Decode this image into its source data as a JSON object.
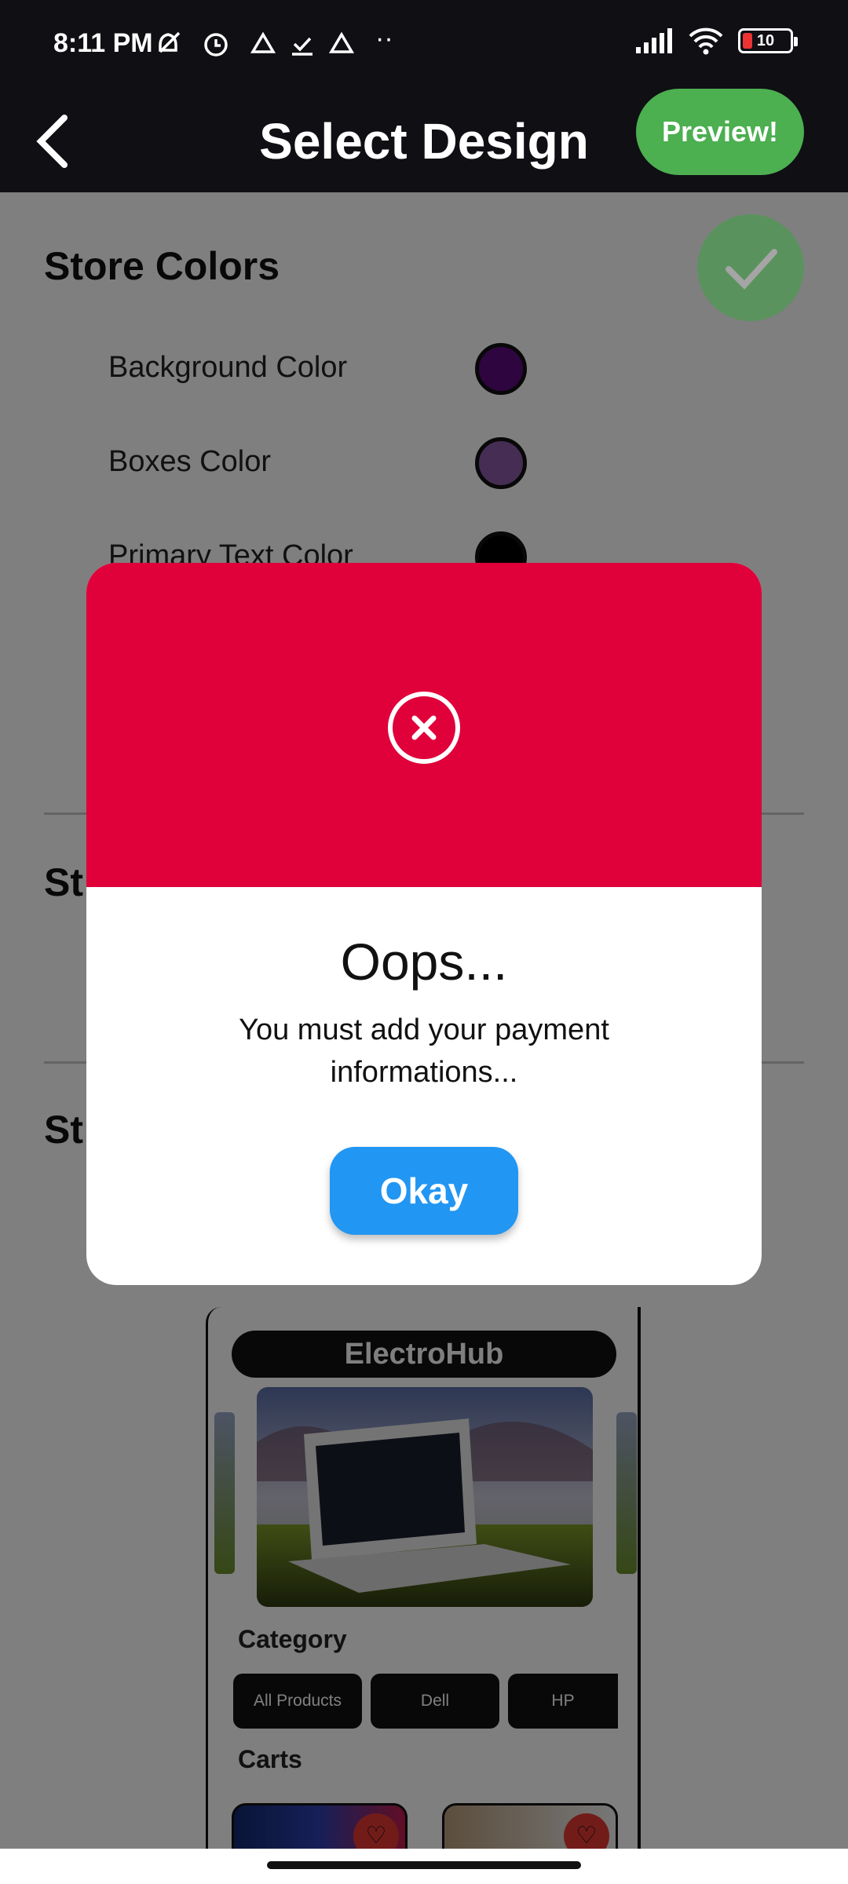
{
  "status_bar": {
    "time": "8:11 PM",
    "battery": "10",
    "icons": [
      "mute-icon",
      "alarm-icon",
      "drive-icon",
      "check-icon",
      "drive-icon",
      "more-icon",
      "signal-icon",
      "wifi-icon",
      "battery-icon"
    ]
  },
  "app_bar": {
    "title": "Select Design",
    "preview_label": "Preview!"
  },
  "sections": {
    "store_colors": {
      "title": "Store Colors",
      "rows": [
        {
          "label": "Background Color",
          "color": "#5C0A7E"
        },
        {
          "label": "Boxes Color",
          "color": "#8B5BA6"
        },
        {
          "label": "Primary Text Color",
          "color": "#000000"
        }
      ]
    },
    "section2_partial": "St",
    "section3_partial": "St"
  },
  "preview": {
    "store_name": "ElectroHub",
    "category_label": "Category",
    "chips": [
      "All Products",
      "Dell",
      "HP"
    ],
    "carts_label": "Carts"
  },
  "dialog": {
    "title": "Oops...",
    "message": "You must add your payment informations...",
    "button_label": "Okay",
    "header_color": "#E0003A",
    "button_color": "#2196F3"
  },
  "colors": {
    "accent_green": "#4CAF50"
  }
}
